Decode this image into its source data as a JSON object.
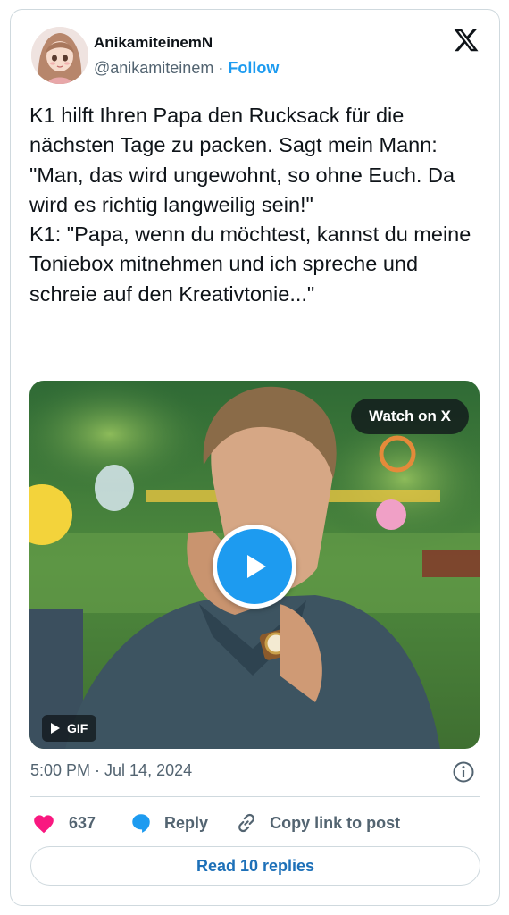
{
  "author": {
    "display_name": "AnikamiteinemN",
    "handle": "@anikamiteinem",
    "separator": " · ",
    "follow_label": "Follow"
  },
  "brand": {
    "logo_icon": "x-logo-icon"
  },
  "tweet": {
    "text": "K1 hilft Ihren Papa den Rucksack für die nächsten Tage zu packen. Sagt mein Mann: \"Man, das wird ungewohnt, so ohne Euch. Da wird es richtig langweilig sein!\"\nK1: \"Papa, wenn du möchtest, kannst du meine Toniebox mitnehmen und ich spreche und schreie auf den Kreativtonie...\"",
    "timestamp": "5:00 PM · Jul 14, 2024"
  },
  "media": {
    "watch_label": "Watch on X",
    "gif_label": "GIF",
    "play_icon": "play-icon"
  },
  "actions": {
    "like_count": "637",
    "reply_label": "Reply",
    "copy_label": "Copy link to post"
  },
  "footer": {
    "read_replies_label": "Read 10 replies"
  },
  "colors": {
    "accent": "#1d9bf0",
    "like": "#f91880",
    "text": "#0f1419",
    "muted": "#536471",
    "border": "#cfd9de"
  }
}
